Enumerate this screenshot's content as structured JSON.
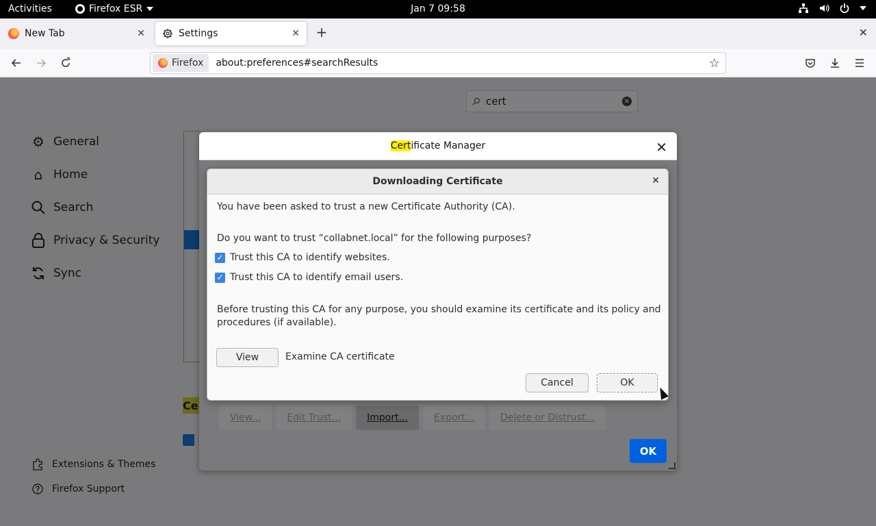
{
  "topbar": {
    "activities": "Activities",
    "app_name": "Firefox ESR",
    "clock": "Jan 7  09:58"
  },
  "tabs": [
    {
      "label": "New Tab"
    },
    {
      "label": "Settings"
    }
  ],
  "urlbar": {
    "identity": "Firefox",
    "url": "about:preferences#searchResults"
  },
  "settings": {
    "search_value": "cert",
    "categories": [
      {
        "label": "General",
        "icon": "gear-icon"
      },
      {
        "label": "Home",
        "icon": "home-icon"
      },
      {
        "label": "Search",
        "icon": "search-icon"
      },
      {
        "label": "Privacy & Security",
        "icon": "lock-icon"
      },
      {
        "label": "Sync",
        "icon": "sync-icon"
      }
    ],
    "footer": {
      "extensions": "Extensions & Themes",
      "support": "Firefox Support"
    },
    "partial_heading": "Ce"
  },
  "cert_manager": {
    "title_highlight": "Cert",
    "title_rest": "ificate Manager",
    "buttons": {
      "view": "View...",
      "edit_trust": "Edit Trust...",
      "import": "Import...",
      "export": "Export...",
      "delete": "Delete or Distrust..."
    },
    "ok": "OK"
  },
  "download_dialog": {
    "title": "Downloading Certificate",
    "line1": "You have been asked to trust a new Certificate Authority (CA).",
    "line2": "Do you want to trust “collabnet.local” for the following purposes?",
    "check_websites": "Trust this CA to identify websites.",
    "check_email": "Trust this CA to identify email users.",
    "check_websites_checked": true,
    "check_email_checked": true,
    "line3a": "Before trusting this CA for any purpose, you should examine its certificate and its policy and",
    "line3b": "procedures (if available).",
    "view_button": "View",
    "view_label": "Examine CA certificate",
    "cancel": "Cancel",
    "ok": "OK"
  },
  "colors": {
    "accent": "#0061e0",
    "checkbox": "#3584e4",
    "highlight": "#ffee00"
  }
}
